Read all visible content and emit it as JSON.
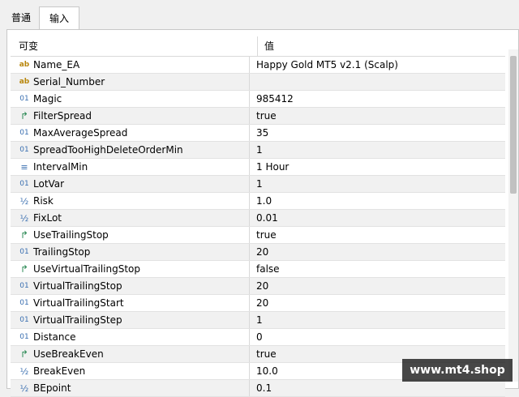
{
  "tabs": [
    {
      "label": "普通"
    },
    {
      "label": "输入"
    }
  ],
  "table": {
    "headers": {
      "variable": "可变",
      "value": "值"
    },
    "rows": [
      {
        "icon": "ab",
        "icon_name": "string-type-icon",
        "name": "Name_EA",
        "value": "Happy Gold MT5 v2.1 (Scalp)"
      },
      {
        "icon": "ab",
        "icon_name": "string-type-icon",
        "name": "Serial_Number",
        "value": ""
      },
      {
        "icon": "01",
        "icon_name": "integer-type-icon",
        "name": "Magic",
        "value": "985412"
      },
      {
        "icon": "↱",
        "icon_name": "bool-type-icon",
        "name": "FilterSpread",
        "value": "true"
      },
      {
        "icon": "01",
        "icon_name": "integer-type-icon",
        "name": "MaxAverageSpread",
        "value": "35"
      },
      {
        "icon": "01",
        "icon_name": "integer-type-icon",
        "name": "SpreadTooHighDeleteOrderMin",
        "value": "1"
      },
      {
        "icon": "≡",
        "icon_name": "enum-type-icon",
        "name": "IntervalMin",
        "value": "1 Hour"
      },
      {
        "icon": "01",
        "icon_name": "integer-type-icon",
        "name": "LotVar",
        "value": "1"
      },
      {
        "icon": "½",
        "icon_name": "double-type-icon",
        "name": "Risk",
        "value": "1.0"
      },
      {
        "icon": "½",
        "icon_name": "double-type-icon",
        "name": "FixLot",
        "value": "0.01"
      },
      {
        "icon": "↱",
        "icon_name": "bool-type-icon",
        "name": "UseTrailingStop",
        "value": "true"
      },
      {
        "icon": "01",
        "icon_name": "integer-type-icon",
        "name": "TrailingStop",
        "value": "20"
      },
      {
        "icon": "↱",
        "icon_name": "bool-type-icon",
        "name": "UseVirtualTrailingStop",
        "value": "false"
      },
      {
        "icon": "01",
        "icon_name": "integer-type-icon",
        "name": "VirtualTrailingStop",
        "value": "20"
      },
      {
        "icon": "01",
        "icon_name": "integer-type-icon",
        "name": "VirtualTrailingStart",
        "value": "20"
      },
      {
        "icon": "01",
        "icon_name": "integer-type-icon",
        "name": "VirtualTrailingStep",
        "value": "1"
      },
      {
        "icon": "01",
        "icon_name": "integer-type-icon",
        "name": "Distance",
        "value": "0"
      },
      {
        "icon": "↱",
        "icon_name": "bool-type-icon",
        "name": "UseBreakEven",
        "value": "true"
      },
      {
        "icon": "½",
        "icon_name": "double-type-icon",
        "name": "BreakEven",
        "value": "10.0"
      },
      {
        "icon": "½",
        "icon_name": "double-type-icon",
        "name": "BEpoint",
        "value": "0.1"
      }
    ]
  },
  "watermark": "www.mt4.shop"
}
